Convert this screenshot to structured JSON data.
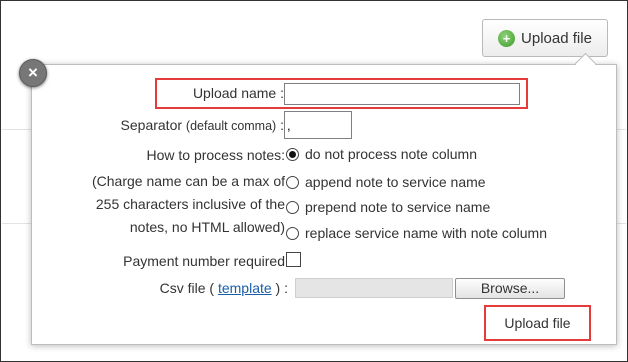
{
  "header": {
    "upload_button_label": "Upload file",
    "upload_button_icon": "plus-circle-icon"
  },
  "popup": {
    "close_icon": "×",
    "upload_name": {
      "label": "Upload name :",
      "value": ""
    },
    "separator": {
      "label_main": "Separator ",
      "label_small": "(default comma)",
      "label_suffix": " :",
      "value": ","
    },
    "notes": {
      "label_lines": [
        "How to process notes:",
        "(Charge name can be a max of",
        "255 characters inclusive of the",
        "notes, no HTML allowed)"
      ],
      "options": [
        {
          "label": "do not process note column",
          "checked": true
        },
        {
          "label": "append note to service name",
          "checked": false
        },
        {
          "label": "prepend note to service name",
          "checked": false
        },
        {
          "label": "replace service name with note column",
          "checked": false
        }
      ]
    },
    "payment_number": {
      "label": "Payment number required",
      "checked": false
    },
    "csv_file": {
      "label_prefix": "Csv file ( ",
      "link_text": "template",
      "label_suffix": " ) :",
      "browse_label": "Browse..."
    },
    "submit_label": "Upload file"
  },
  "colors": {
    "highlight": "#e53b3b",
    "link": "#1a5ea8",
    "icon_green": "#3e9b2a"
  }
}
